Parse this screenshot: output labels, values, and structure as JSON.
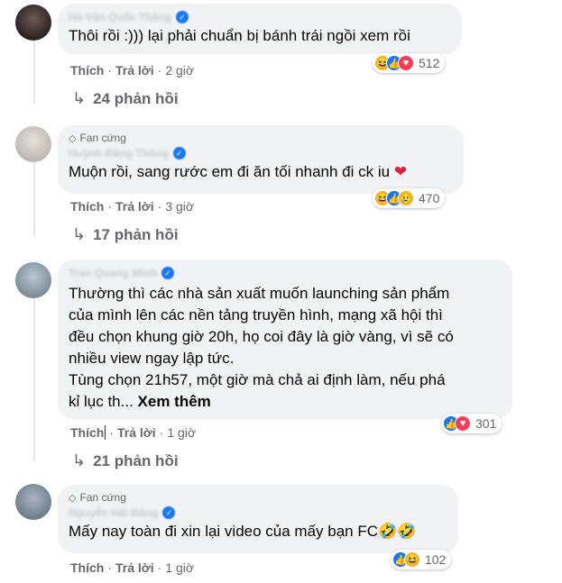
{
  "comments": [
    {
      "author": "Hà Văn Quốc Thắng",
      "badge": "",
      "lines": [
        "Thôi rồi :))) lại phải chuẩn bị bánh trái ngồi xem rồi"
      ],
      "actions": {
        "like": "Thích",
        "reply": "Trả lời",
        "time": "2 giờ"
      },
      "reactions": {
        "icons": [
          "haha-icon",
          "like-icon",
          "love-icon"
        ],
        "count": "512"
      },
      "replies": "24 phản hồi"
    },
    {
      "author": "Huỳnh Đăng Thông",
      "badge": "Fan cứng",
      "lines": [
        "Muộn rồi, sang rước em đi ăn tối nhanh đi ck iu"
      ],
      "emoji": "❤",
      "actions": {
        "like": "Thích",
        "reply": "Trả lời",
        "time": "3 giờ"
      },
      "reactions": {
        "icons": [
          "haha-icon",
          "like-icon",
          "sad-icon"
        ],
        "count": "470"
      },
      "replies": "17 phản hồi"
    },
    {
      "author": "Tran Quang Minh",
      "badge": "",
      "lines": [
        "Thường thì các nhà sản xuất muốn launching sản phẩm",
        "của mình lên các nền tảng truyền hình, mạng xã hội thì",
        "đều chọn khung giờ 20h, họ coi đây là giờ vàng, vì sẽ có",
        "nhiều view ngay lập tức.",
        "Tùng chọn 21h57, một giờ mà chả ai định làm, nếu phá"
      ],
      "last_line": "kỉ lục th...",
      "see_more": "Xem thêm",
      "actions": {
        "like": "Thích",
        "reply": "Trả lời",
        "time": "1 giờ"
      },
      "reactions": {
        "icons": [
          "like-icon",
          "love-icon"
        ],
        "count": "301"
      },
      "replies": "21 phản hồi"
    },
    {
      "author": "Nguyễn Hải Đăng",
      "badge": "Fan cứng",
      "lines": [
        "Mấy nay toàn đi xin lại video của mấy bạn FC"
      ],
      "emoji": "🤣🤣",
      "actions": {
        "like": "Thích",
        "reply": "Trả lời",
        "time": "1 giờ"
      },
      "reactions": {
        "icons": [
          "like-icon",
          "haha-icon"
        ],
        "count": "102"
      }
    }
  ],
  "colors": {
    "bubble": "#f0f2f5",
    "secondary_text": "#65676b",
    "like_blue": "#1877f2",
    "love_red": "#f33e58",
    "haha_yellow": "#f7b125"
  }
}
